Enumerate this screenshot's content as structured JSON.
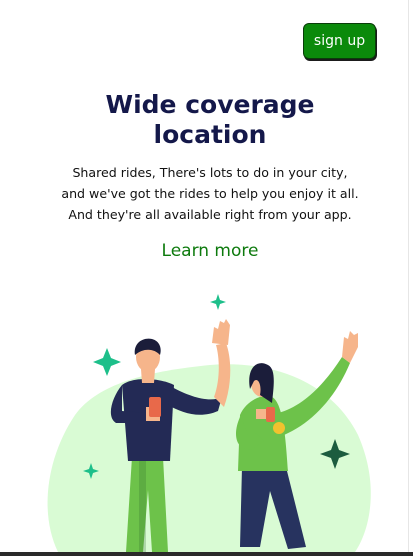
{
  "header": {
    "signup_label": "sign up"
  },
  "hero": {
    "title_line1": "Wide coverage",
    "title_line2": "location",
    "description_line1": "Shared rides, There's lots to do in your city,",
    "description_line2": "and we've got the rides to help you enjoy it all.",
    "description_line3": "And they're all available right from your app.",
    "learn_more_label": "Learn more"
  },
  "colors": {
    "brand_green": "#0b8a0b",
    "title_navy": "#14184a",
    "link_green": "#0d7a0d",
    "illustration_blob": "#d9fbd4",
    "sparkle_teal": "#1dbf8a"
  }
}
